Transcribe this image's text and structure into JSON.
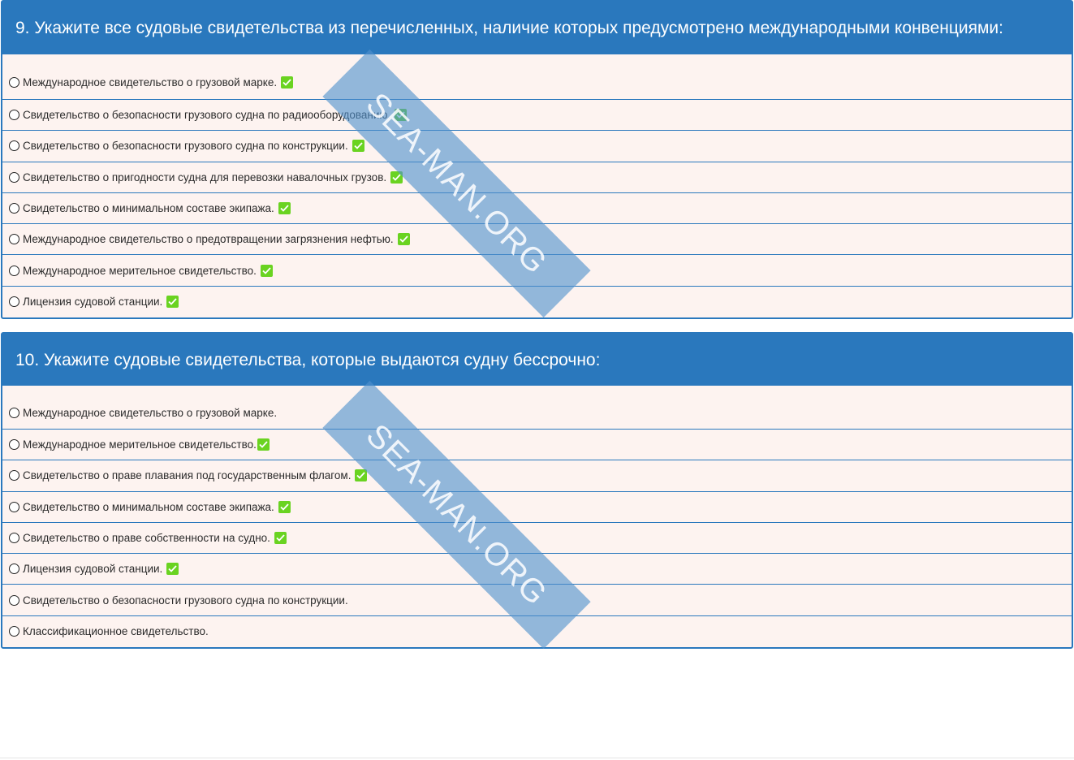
{
  "questions": [
    {
      "title": "9. Укажите все судовые свидетельства из перечисленных, наличие которых предусмотрено международными конвенциями:",
      "options": [
        {
          "label": "Международное свидетельство о грузовой марке.",
          "checked": true
        },
        {
          "label": "Свидетельство о безопасности грузового судна по радиооборудованию.",
          "checked": true
        },
        {
          "label": "Свидетельство о безопасности грузового судна по конструкции.",
          "checked": true
        },
        {
          "label": "Свидетельство о пригодности судна для перевозки навалочных грузов.",
          "checked": true
        },
        {
          "label": "Свидетельство о минимальном составе экипажа.",
          "checked": true
        },
        {
          "label": "Международное свидетельство о предотвращении загрязнения нефтью.",
          "checked": true
        },
        {
          "label": "Международное мерительное свидетельство.",
          "checked": true
        },
        {
          "label": "Лицензия судовой станции.",
          "checked": true
        }
      ]
    },
    {
      "title": "10. Укажите судовые свидетельства, которые выдаются судну бессрочно:",
      "options": [
        {
          "label": "Международное свидетельство о грузовой марке.",
          "checked": false
        },
        {
          "label": "Международное мерительное свидетельство.",
          "checked": true
        },
        {
          "label": "Свидетельство о праве плавания под государственным флагом.",
          "checked": true
        },
        {
          "label": "Свидетельство о минимальном составе экипажа.",
          "checked": true
        },
        {
          "label": "Свидетельство о праве собственности на судно.",
          "checked": true
        },
        {
          "label": "Лицензия судовой станции.",
          "checked": true
        },
        {
          "label": "Свидетельство о безопасности грузового судна по конструкции.",
          "checked": false
        },
        {
          "label": "Классификационное свидетельство.",
          "checked": false
        }
      ]
    }
  ],
  "watermark": "SEA-MAN.ORG",
  "colors": {
    "header": "#2a78bd",
    "body": "#fdf3f0",
    "check": "#6ad321"
  },
  "icons": {
    "radio": "radio-button-icon",
    "check": "checkmark-icon"
  }
}
